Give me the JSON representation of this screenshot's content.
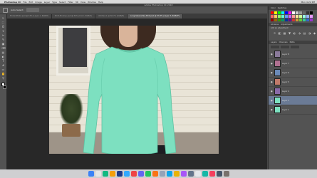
{
  "menubar": {
    "apple_glyph": "",
    "app_name": "Photoshop CC",
    "items": [
      "File",
      "Edit",
      "Image",
      "Layer",
      "Type",
      "Select",
      "Filter",
      "3D",
      "View",
      "Window",
      "Help"
    ],
    "right_items": [
      "Mon 4:22 PM"
    ]
  },
  "app_title": "Adobe Photoshop CC 2018",
  "optbar": {
    "mode_label": "Auto-Select:"
  },
  "tabs": [
    {
      "label": "Model-Photo.psd @ 33% (Layer 1, RGB/8)",
      "active": false
    },
    {
      "label": "Shirt-Mockup.psd @ 50% (Color, RGB/8)",
      "active": false
    },
    {
      "label": "Untitled-1 @ 66.7% (RGB/8)",
      "active": false
    },
    {
      "label": "Long-Sleeve-Tee-Mint.psd @ 33.3% (Layer 3, RGB/8*)",
      "active": true
    }
  ],
  "tools": [
    "↖",
    "⬚",
    "ʘ",
    "⌖",
    "✂",
    "✎",
    "▣",
    "⌫",
    "▤",
    "◐",
    "T",
    "⬈",
    "▭",
    "✋",
    "⚲"
  ],
  "panels": {
    "swatches_tabs": [
      "Color",
      "Swatches"
    ],
    "adjust_tabs": [
      "Libraries",
      "Adjustments"
    ],
    "adjust_title": "Add an adjustment",
    "adjust_icons": [
      "☼",
      "◧",
      "▦",
      "▼",
      "◐",
      "⬗",
      "▤",
      "◑",
      "◆"
    ],
    "layers_tabs": [
      "Layers",
      "Channels",
      "Paths"
    ],
    "layers": [
      {
        "name": "Layer 8",
        "active": false,
        "thumb": "#8a7a9a"
      },
      {
        "name": "Layer 7",
        "active": false,
        "thumb": "#b07090"
      },
      {
        "name": "Layer 6",
        "active": false,
        "thumb": "#6b8ab8"
      },
      {
        "name": "Layer 5",
        "active": false,
        "thumb": "#c07a6a"
      },
      {
        "name": "Layer 4",
        "active": false,
        "thumb": "#8a6aa8"
      },
      {
        "name": "Layer 3",
        "active": true,
        "thumb": "#7de0c0"
      },
      {
        "name": "Layer 1",
        "active": false,
        "thumb": "#7de0c0"
      }
    ]
  },
  "shirt_color": "#7de0c0",
  "dock_colors": [
    "#3b82f6",
    "#e5e5e5",
    "#10b981",
    "#f59e0b",
    "#1e3a8a",
    "#31a8ff",
    "#ef4444",
    "#6366f1",
    "#22c55e",
    "#f97316",
    "#94a3b8",
    "#0ea5e9",
    "#eab308",
    "#a855f7",
    "#64748b",
    "#e5e7eb",
    "#14b8a6",
    "#f43f5e",
    "#475569",
    "#78716c"
  ],
  "swatch_colors": [
    "#ff0000",
    "#ffff00",
    "#00ff00",
    "#00ffff",
    "#0000ff",
    "#ff00ff",
    "#ffffff",
    "#cccccc",
    "#999999",
    "#666666",
    "#333333",
    "#000000",
    "#ff6666",
    "#ffcc66",
    "#99ff66",
    "#66ffcc",
    "#6699ff",
    "#cc66ff",
    "#ff9999",
    "#ffe699",
    "#ccff99",
    "#99ffe6",
    "#99b3ff",
    "#e699ff",
    "#990000",
    "#996600",
    "#339900",
    "#009966",
    "#003399",
    "#660099",
    "#cc3333",
    "#cc9933",
    "#66cc33",
    "#33cc99",
    "#3366cc",
    "#9933cc"
  ]
}
